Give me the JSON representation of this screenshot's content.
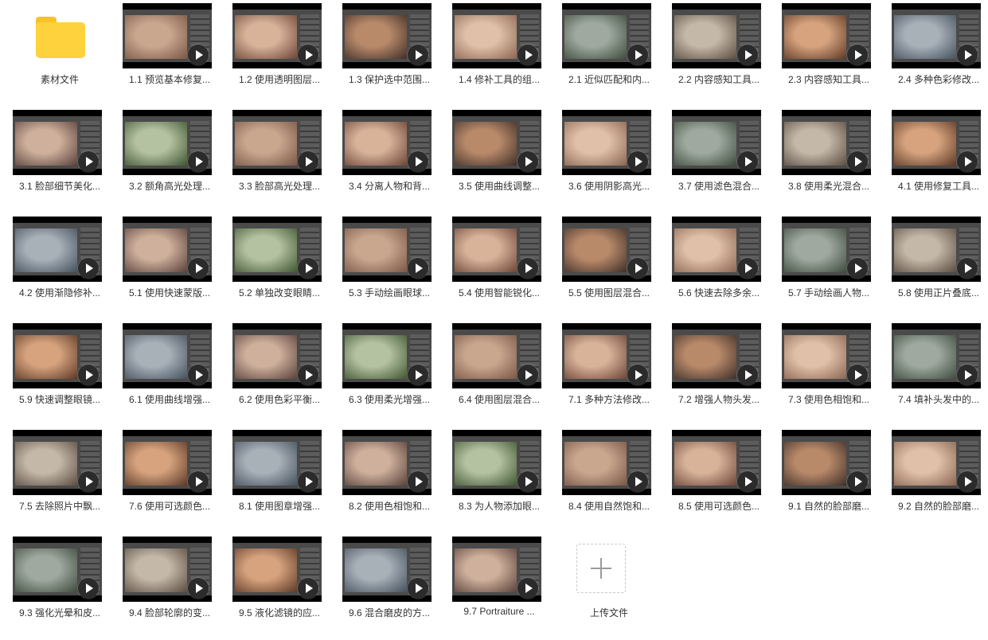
{
  "folder": {
    "label": "素材文件",
    "icon": "folder-icon",
    "color": "#fdd23c"
  },
  "upload": {
    "label": "上传文件",
    "icon": "plus-icon"
  },
  "selected_index": 50,
  "videos": [
    "1.1 预览基本修复...",
    "1.2 使用透明图层...",
    "1.3 保护选中范围...",
    "1.4 修补工具的组...",
    "2.1 近似匹配和内...",
    "2.2 内容感知工具...",
    "2.3 内容感知工具...",
    "2.4 多种色彩修改...",
    "3.1 脸部细节美化...",
    "3.2 额角高光处理...",
    "3.3 脸部高光处理...",
    "3.4 分离人物和背...",
    "3.5 使用曲线调整...",
    "3.6 使用阴影高光...",
    "3.7 使用滤色混合...",
    "3.8 使用柔光混合...",
    "4.1 使用修复工具...",
    "4.2 使用渐隐修补...",
    "5.1 使用快速蒙版...",
    "5.2 单独改变眼睛...",
    "5.3 手动绘画眼球...",
    "5.4 使用智能锐化...",
    "5.5 使用图层混合...",
    "5.6 快速去除多余...",
    "5.7 手动绘画人物...",
    "5.8 使用正片叠底...",
    "5.9 快速调整眼镜...",
    "6.1 使用曲线增强...",
    "6.2 使用色彩平衡...",
    "6.3 使用柔光增强...",
    "6.4 使用图层混合...",
    "7.1 多种方法修改...",
    "7.2 增强人物头发...",
    "7.3 使用色相饱和...",
    "7.4 填补头发中的...",
    "7.5 去除照片中飘...",
    "7.6 使用可选颜色...",
    "8.1 使用图章增强...",
    "8.2 使用色相饱和...",
    "8.3 为人物添加眼...",
    "8.4 使用自然饱和...",
    "8.5 使用可选颜色...",
    "9.1 自然的脸部磨...",
    "9.2 自然的脸部磨...",
    "9.3 强化光晕和皮...",
    "9.4 脸部轮廓的变...",
    "9.5 液化滤镜的应...",
    "9.6 混合磨皮的方...",
    "9.7 Portraiture ..."
  ]
}
